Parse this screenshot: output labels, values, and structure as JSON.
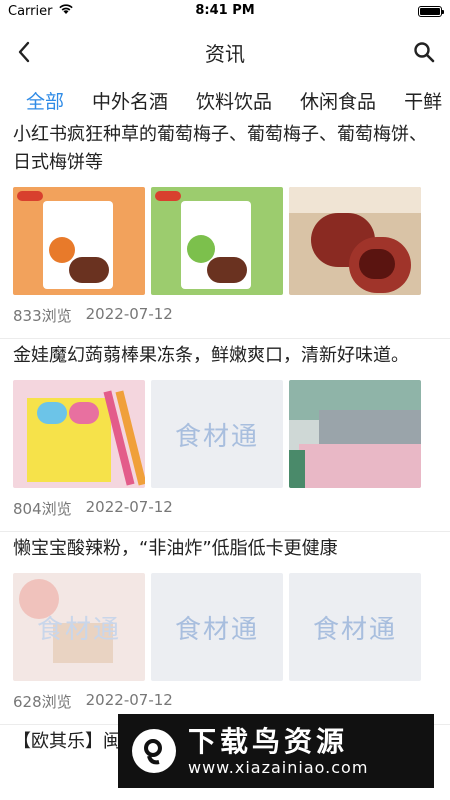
{
  "status": {
    "carrier": "Carrier",
    "time": "8:41 PM"
  },
  "nav": {
    "title": "资讯"
  },
  "tabs": [
    {
      "label": "全部",
      "active": true
    },
    {
      "label": "中外名酒",
      "active": false
    },
    {
      "label": "饮料饮品",
      "active": false
    },
    {
      "label": "休闲食品",
      "active": false
    },
    {
      "label": "干鲜",
      "active": false
    }
  ],
  "articles": [
    {
      "title": "小红书疯狂种草的葡萄梅子、葡萄梅子、葡萄梅饼、日式梅饼等",
      "views": "833浏览",
      "date": "2022-07-12",
      "images": [
        "plum-pack-orange",
        "plum-pack-green",
        "plum-cake-closeup"
      ]
    },
    {
      "title": "金娃魔幻蒟蒻棒果冻条，鲜嫩爽口，清新好味道。",
      "views": "804浏览",
      "date": "2022-07-12",
      "images": [
        "jelly-sticks",
        "placeholder",
        "factory-line"
      ]
    },
    {
      "title": "懒宝宝酸辣粉，“非油炸”低脂低卡更健康",
      "views": "628浏览",
      "date": "2022-07-12",
      "images": [
        "noodle-faded",
        "placeholder",
        "placeholder"
      ]
    },
    {
      "title": "【欧其乐】闽台风味肉松饼",
      "views": "",
      "date": "",
      "images": []
    }
  ],
  "placeholder_text": "食材通",
  "watermark": {
    "title": "下载鸟资源",
    "url": "www.xiazainiao.com"
  },
  "colors": {
    "accent": "#2f8be6",
    "text": "#222222",
    "meta": "#777777"
  }
}
